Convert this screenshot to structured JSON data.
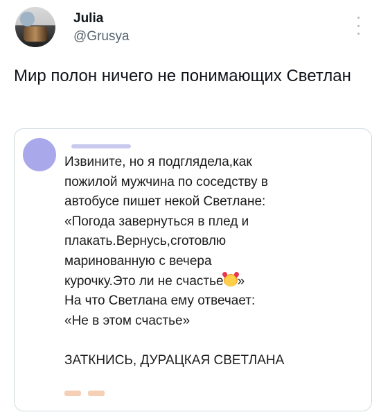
{
  "author": {
    "name": "Julia",
    "handle": "@Grusya"
  },
  "tweet": {
    "text": "Мир полон ничего не понимающих Светлан"
  },
  "post": {
    "lines": [
      "Извините, но я подглядела,как",
      "пожилой мужчина по соседству в",
      "автобусе пишет некой Светлане:",
      "«Погода завернуться в плед и",
      "плакать.Вернусь,сготовлю",
      "маринованную с вечера",
      "курочку.Это ли не счастье",
      "»",
      "На что Светлана ему отвечает:",
      "«Не в этом счастье»",
      "ЗАТКНИСЬ, ДУРАЦКАЯ СВЕТЛАНА"
    ],
    "emoji": "smiling-face-with-hearts-icon"
  }
}
